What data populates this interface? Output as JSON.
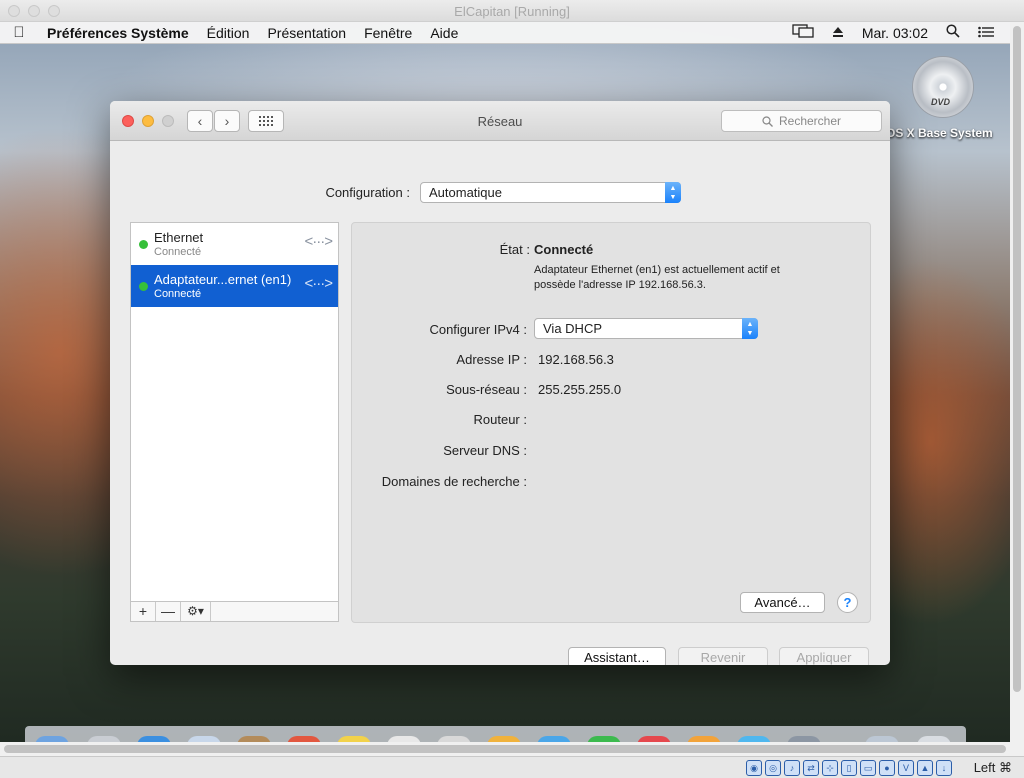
{
  "host": {
    "title": "ElCapitan [Running]",
    "host_key": "Left ⌘"
  },
  "menubar": {
    "app": "Préférences Système",
    "menus": [
      "Édition",
      "Présentation",
      "Fenêtre",
      "Aide"
    ],
    "clock": "Mar. 03:02"
  },
  "desktop": {
    "volume_label": "OS X Base System",
    "dvd_text": "DVD"
  },
  "window": {
    "title": "Réseau",
    "search_placeholder": "Rechercher",
    "configuration_label": "Configuration :",
    "configuration_value": "Automatique"
  },
  "services": [
    {
      "name": "Ethernet",
      "status": "Connecté",
      "selected": false
    },
    {
      "name": "Adaptateur...ernet (en1)",
      "status": "Connecté",
      "selected": true
    }
  ],
  "details": {
    "state_label": "État :",
    "state_value": "Connecté",
    "state_desc": "Adaptateur Ethernet (en1) est actuellement actif et possède l'adresse IP 192.168.56.3.",
    "ipv4_label": "Configurer IPv4 :",
    "ipv4_value": "Via DHCP",
    "ip_label": "Adresse IP :",
    "ip_value": "192.168.56.3",
    "subnet_label": "Sous-réseau :",
    "subnet_value": "255.255.255.0",
    "router_label": "Routeur :",
    "dns_label": "Serveur DNS :",
    "search_domains_label": "Domaines de recherche :",
    "advanced_button": "Avancé…",
    "help": "?"
  },
  "footer": {
    "assistant": "Assistant…",
    "revert": "Revenir",
    "apply": "Appliquer"
  },
  "colors": {
    "selection": "#1160d2",
    "status_green": "#36c03a",
    "accent": "#1a82fb"
  }
}
